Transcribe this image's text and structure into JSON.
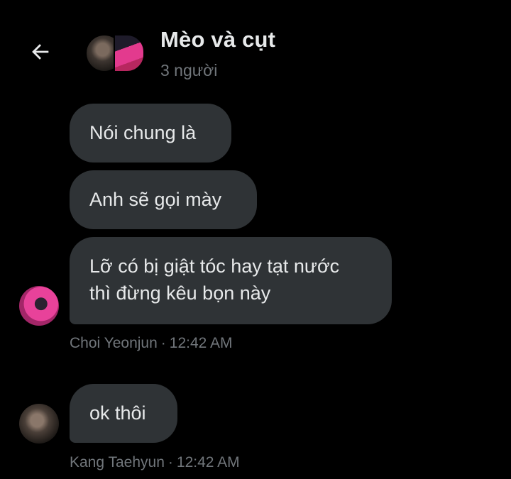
{
  "header": {
    "back_icon": "arrow-left-icon",
    "title": "Mèo và cụt",
    "subtitle": "3 người"
  },
  "messages": [
    {
      "text": "Nói chung là"
    },
    {
      "text": "Anh sẽ gọi mày"
    },
    {
      "lines": [
        "Lỡ có bị giật tóc hay tạt nước",
        "thì đừng kêu bọn này"
      ]
    },
    {
      "text": "ok thôi"
    }
  ],
  "meta": [
    {
      "sender": "Choi Yeonjun",
      "separator": "·",
      "time": "12:42 AM"
    },
    {
      "sender": "Kang Taehyun",
      "separator": "·",
      "time": "12:42 AM"
    }
  ],
  "colors": {
    "background": "#000000",
    "bubble": "#2f3336",
    "text": "#e7e9ea",
    "muted": "#71767b"
  }
}
